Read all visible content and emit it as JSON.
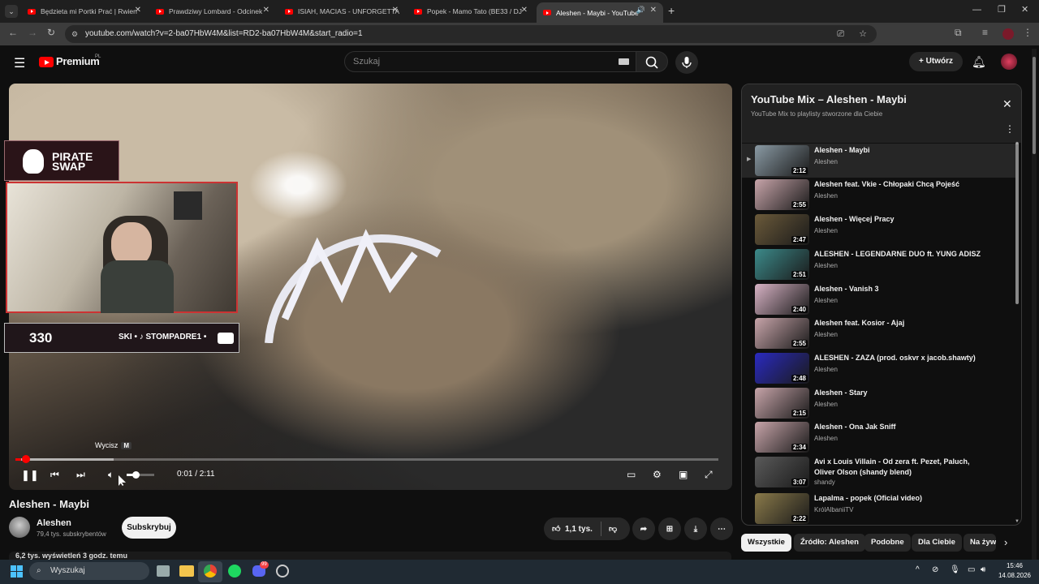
{
  "browser": {
    "tabs": [
      {
        "title": "Będzieta mi Portki Prać | Rwien",
        "active": false
      },
      {
        "title": "Prawdziwy Lombard - Odcinek",
        "active": false
      },
      {
        "title": "ISIAH, MACIAS - UNFORGETTA",
        "active": false
      },
      {
        "title": "Popek - Mamo Tato (BE33 / DJ",
        "active": false
      },
      {
        "title": "Aleshen - Maybi - YouTube",
        "active": true
      }
    ],
    "url": "youtube.com/watch?v=2-ba07HbW4M&list=RD2-ba07HbW4M&start_radio=1"
  },
  "youtube": {
    "logo": "Premium",
    "logo_sup": "PL",
    "search_placeholder": "Szukaj",
    "create_label": "Utwórz"
  },
  "player": {
    "overlay_brand": "PIRATE SWAP",
    "overlay_count": "330",
    "overlay_ticker": "SKI • ♪ STOMPADRE1 •",
    "tooltip": "Wycisz",
    "tooltip_key": "M",
    "time": "0:01 / 2:11",
    "progress_fraction": 0.008,
    "buffered_fraction": 0.14,
    "volume_fraction": 0.4
  },
  "video": {
    "title": "Aleshen - Maybi",
    "channel": "Aleshen",
    "subscribers": "79,4 tys. subskrybentów",
    "subscribe_label": "Subskrybuj",
    "likes": "1,1 tys.",
    "views_line": "6,2 tys. wyświetleń  3 godz. temu"
  },
  "playlist": {
    "title": "YouTube Mix – Aleshen - Maybi",
    "subtitle": "YouTube Mix to playlisty stworzone dla Ciebie",
    "items": [
      {
        "title": "Aleshen - Maybi",
        "author": "Aleshen",
        "duration": "2:12",
        "current": true,
        "thumb": "#8a9aa4"
      },
      {
        "title": "Aleshen feat. Vkie - Chłopaki Chcą Pojeść",
        "author": "Aleshen",
        "duration": "2:55",
        "current": false,
        "thumb": "#c7a4a9"
      },
      {
        "title": "Aleshen - Więcej Pracy",
        "author": "Aleshen",
        "duration": "2:47",
        "current": false,
        "thumb": "#6b5a3a"
      },
      {
        "title": "ALESHEN - LEGENDARNE DUO ft. YUNG ADISZ",
        "author": "Aleshen",
        "duration": "2:51",
        "current": false,
        "thumb": "#3c8a8a"
      },
      {
        "title": "Aleshen - Vanish 3",
        "author": "Aleshen",
        "duration": "2:40",
        "current": false,
        "thumb": "#d7b2c4"
      },
      {
        "title": "Aleshen feat. Kosior - Ajaj",
        "author": "Aleshen",
        "duration": "2:55",
        "current": false,
        "thumb": "#c7a4a9"
      },
      {
        "title": "ALESHEN - ZAZA (prod. oskvr x jacob.shawty)",
        "author": "Aleshen",
        "duration": "2:48",
        "current": false,
        "thumb": "#2a2ac0"
      },
      {
        "title": "Aleshen - Stary",
        "author": "Aleshen",
        "duration": "2:15",
        "current": false,
        "thumb": "#c7a4a9"
      },
      {
        "title": "Aleshen - Ona Jak Sniff",
        "author": "Aleshen",
        "duration": "2:34",
        "current": false,
        "thumb": "#c7a4a9"
      },
      {
        "title": "Avi x Louis Villain - Od zera ft. Pezet, Paluch, Oliver Olson (shandy blend)",
        "author": "shandy",
        "duration": "3:07",
        "current": false,
        "thumb": "#5a5a5a"
      },
      {
        "title": "Lapalma - popek (Oficial video)",
        "author": "KrólAlbaniiTV",
        "duration": "2:22",
        "current": false,
        "thumb": "#8a7a4a"
      }
    ]
  },
  "chips": [
    "Wszystkie",
    "Źródło: Aleshen",
    "Podobne",
    "Dla Ciebie",
    "Na żywo"
  ],
  "taskbar": {
    "search_label": "Wyszukaj",
    "time": "15:46",
    "date": "14.08.2026",
    "discord_badge": "99"
  }
}
